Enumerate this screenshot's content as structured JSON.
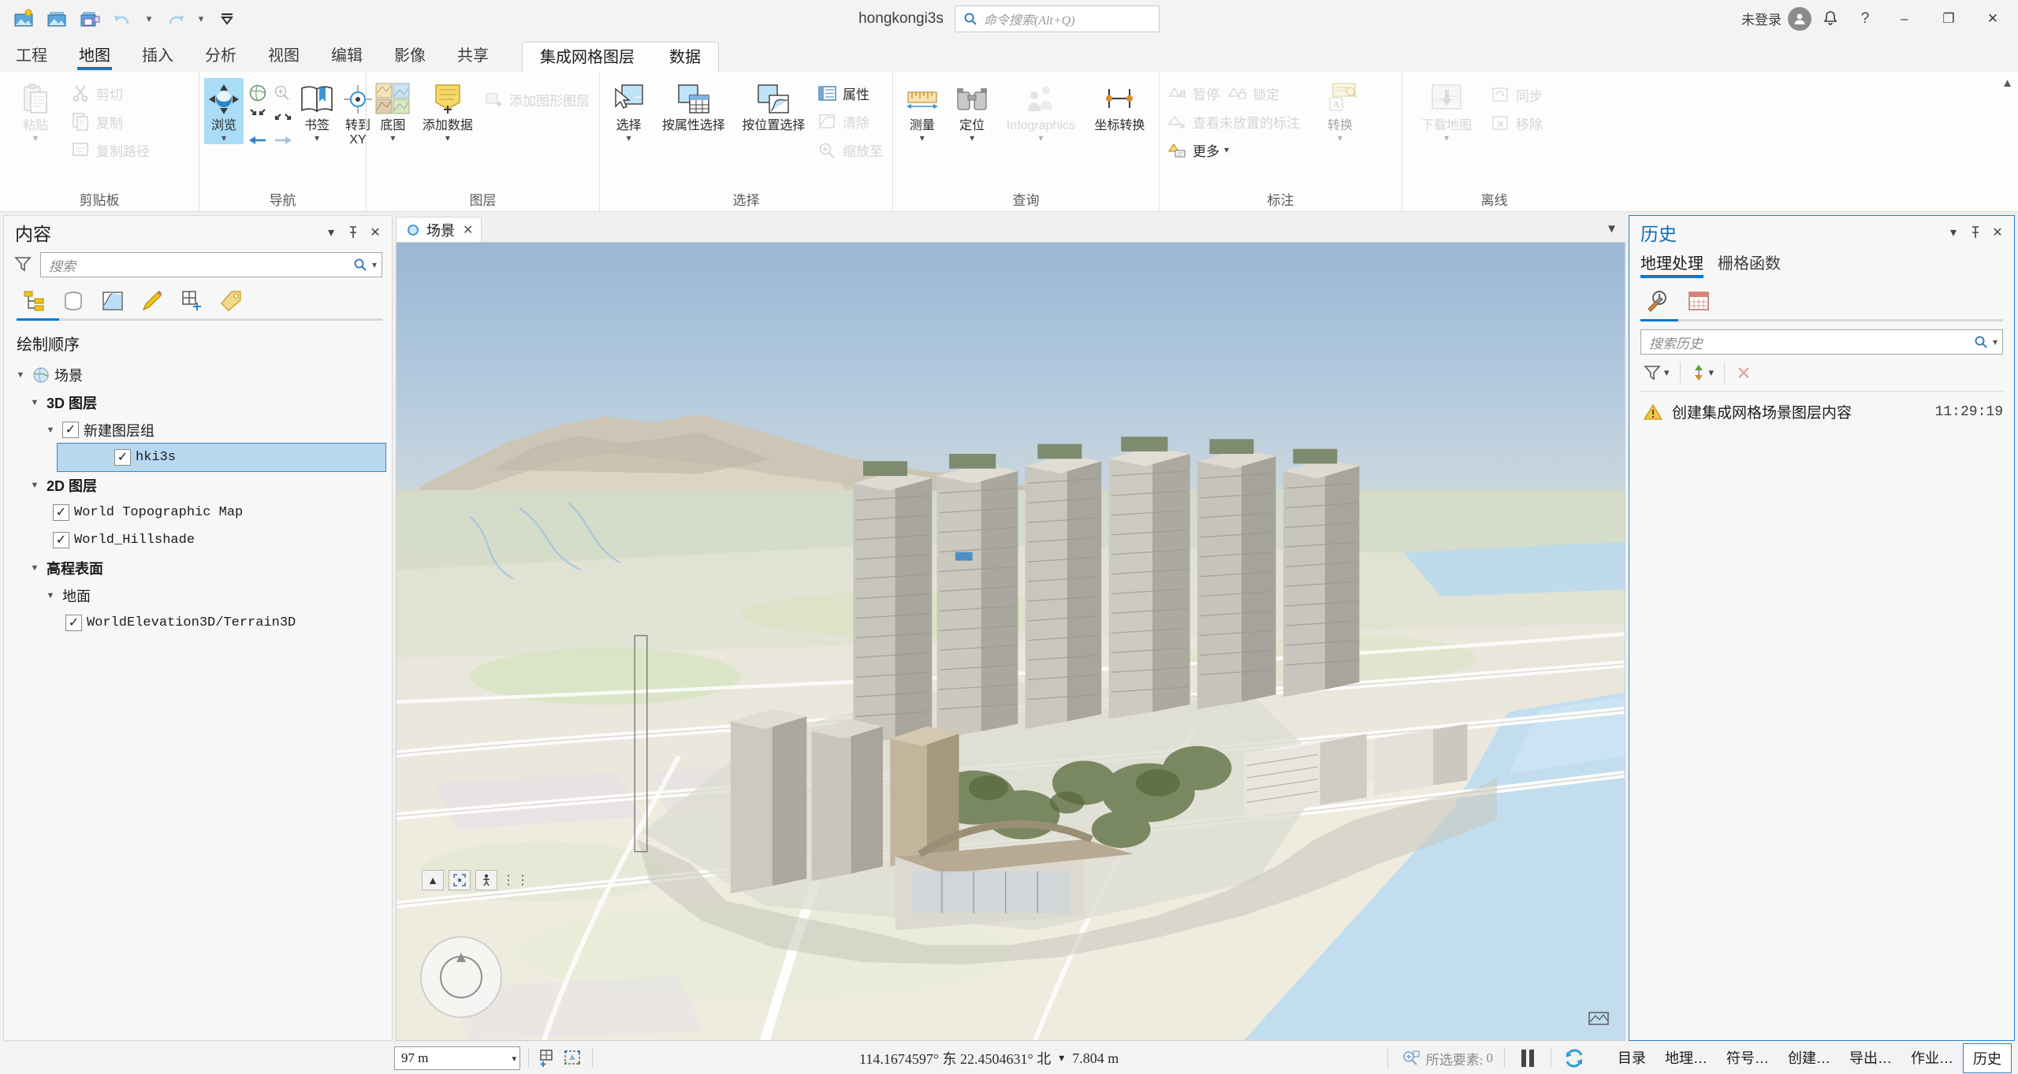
{
  "titlebar": {
    "project_title": "hongkongi3s",
    "command_search_placeholder": "命令搜索(Alt+Q)",
    "sign_in_label": "未登录",
    "quick_access": [
      {
        "name": "new-project",
        "tooltip": "新建工程"
      },
      {
        "name": "open-project",
        "tooltip": "打开工程"
      },
      {
        "name": "save-project",
        "tooltip": "保存工程"
      },
      {
        "name": "undo",
        "tooltip": "撤消"
      },
      {
        "name": "redo",
        "tooltip": "恢复"
      },
      {
        "name": "customize-qat",
        "tooltip": "自定义快速访问工具栏"
      }
    ],
    "window_controls": {
      "minimize": "–",
      "maximize": "❐",
      "close": "✕"
    }
  },
  "ribbon_tabs": [
    {
      "label": "工程",
      "active": false
    },
    {
      "label": "地图",
      "active": true
    },
    {
      "label": "插入",
      "active": false
    },
    {
      "label": "分析",
      "active": false
    },
    {
      "label": "视图",
      "active": false
    },
    {
      "label": "编辑",
      "active": false
    },
    {
      "label": "影像",
      "active": false
    },
    {
      "label": "共享",
      "active": false
    }
  ],
  "contextual_tabs": {
    "group_name": "集成网格图层",
    "tabs": [
      {
        "label": "集成网格图层",
        "active": true
      },
      {
        "label": "数据",
        "active": false
      }
    ]
  },
  "ribbon_groups": [
    {
      "label": "剪贴板",
      "big": [
        {
          "label": "粘贴",
          "icon": "paste-icon",
          "disabled": true,
          "has_menu": true
        }
      ],
      "small": [
        {
          "label": "剪切",
          "icon": "cut-icon",
          "disabled": true
        },
        {
          "label": "复制",
          "icon": "copy-icon",
          "disabled": true
        },
        {
          "label": "复制路径",
          "icon": "copy-path-icon",
          "disabled": true
        }
      ]
    },
    {
      "label": "导航",
      "big": [
        {
          "label": "浏览",
          "icon": "explore-icon",
          "active": true,
          "has_menu": true
        },
        {
          "label": "书签",
          "icon": "bookmark-icon",
          "has_menu": true
        },
        {
          "label": "转到 XY",
          "icon": "go-to-xy-icon",
          "has_menu": true
        }
      ],
      "grid": [
        {
          "icon": "full-extent-icon"
        },
        {
          "icon": "fixed-zoom-in-icon"
        },
        {
          "icon": "zoom-in-box-icon"
        },
        {
          "icon": "zoom-out-box-icon"
        },
        {
          "icon": "previous-extent-icon"
        },
        {
          "icon": "next-extent-icon"
        }
      ]
    },
    {
      "label": "图层",
      "big": [
        {
          "label": "底图",
          "icon": "basemap-icon",
          "has_menu": true
        },
        {
          "label": "添加数据",
          "icon": "add-data-icon",
          "has_menu": true
        }
      ],
      "small": [
        {
          "label": "添加图形图层",
          "icon": "add-graphics-layer-icon",
          "disabled": true
        }
      ]
    },
    {
      "label": "选择",
      "big": [
        {
          "label": "选择",
          "icon": "select-icon",
          "has_menu": true
        },
        {
          "label": "按属性选择",
          "icon": "select-by-attributes-icon"
        },
        {
          "label": "按位置选择",
          "icon": "select-by-location-icon"
        }
      ],
      "small": [
        {
          "label": "属性",
          "icon": "attributes-icon"
        },
        {
          "label": "清除",
          "icon": "clear-selection-icon",
          "disabled": true
        },
        {
          "label": "缩放至",
          "icon": "zoom-to-selection-icon",
          "disabled": true
        }
      ],
      "has_dialog_launcher": true
    },
    {
      "label": "查询",
      "big": [
        {
          "label": "测量",
          "icon": "measure-icon",
          "has_menu": true
        },
        {
          "label": "定位",
          "icon": "locate-icon",
          "has_menu": true
        },
        {
          "label": "Infographics",
          "icon": "infographics-icon",
          "disabled": true,
          "has_menu": true
        },
        {
          "label": "坐标转换",
          "icon": "coordinate-conversion-icon"
        }
      ]
    },
    {
      "label": "标注",
      "small": [
        {
          "label": "暂停",
          "icon": "pause-labeling-icon",
          "disabled": true
        },
        {
          "label": "锁定",
          "icon": "lock-labeling-icon",
          "disabled": true
        },
        {
          "label": "查看未放置的标注",
          "icon": "view-unplaced-labels-icon",
          "disabled": true
        },
        {
          "label": "更多",
          "icon": "more-labeling-icon",
          "has_menu": true
        }
      ],
      "big": [
        {
          "label": "转换",
          "icon": "convert-labels-icon",
          "disabled": true,
          "has_menu": true
        }
      ],
      "has_dialog_launcher": true
    },
    {
      "label": "离线",
      "big": [
        {
          "label": "下载地图",
          "icon": "download-map-icon",
          "disabled": true,
          "has_menu": true
        }
      ],
      "small": [
        {
          "label": "同步",
          "icon": "sync-icon",
          "disabled": true
        },
        {
          "label": "移除",
          "icon": "remove-offline-icon",
          "disabled": true
        }
      ],
      "has_dialog_launcher": true
    }
  ],
  "contents_pane": {
    "title": "内容",
    "search_placeholder": "搜索",
    "tab_icons": [
      {
        "name": "list-by-drawing-order-icon",
        "active": true
      },
      {
        "name": "list-by-data-source-icon",
        "active": false
      },
      {
        "name": "list-by-selection-icon",
        "active": false
      },
      {
        "name": "list-by-editing-icon",
        "active": false
      },
      {
        "name": "list-by-snapping-icon",
        "active": false
      },
      {
        "name": "list-by-labeling-icon",
        "active": false
      }
    ],
    "section_title": "绘制顺序",
    "tree": [
      {
        "label": "场景",
        "indent": 0,
        "arrow": "down",
        "checkbox": null,
        "icon": "globe-icon",
        "bold": false,
        "selected": false,
        "mono": false
      },
      {
        "label": "3D 图层",
        "indent": 1,
        "arrow": "down",
        "checkbox": null,
        "icon": null,
        "bold": true,
        "selected": false,
        "mono": false
      },
      {
        "label": "新建图层组",
        "indent": 2,
        "arrow": "down",
        "checkbox": true,
        "icon": null,
        "bold": false,
        "selected": false,
        "mono": false
      },
      {
        "label": "hki3s",
        "indent": 3,
        "arrow": null,
        "checkbox": true,
        "icon": null,
        "bold": false,
        "selected": true,
        "mono": true
      },
      {
        "label": "2D 图层",
        "indent": 1,
        "arrow": "down",
        "checkbox": null,
        "icon": null,
        "bold": true,
        "selected": false,
        "mono": false
      },
      {
        "label": "World Topographic Map",
        "indent": 2,
        "arrow": null,
        "checkbox": true,
        "icon": null,
        "bold": false,
        "selected": false,
        "mono": true
      },
      {
        "label": "World_Hillshade",
        "indent": 2,
        "arrow": null,
        "checkbox": true,
        "icon": null,
        "bold": false,
        "selected": false,
        "mono": true
      },
      {
        "label": "高程表面",
        "indent": 1,
        "arrow": "down",
        "checkbox": null,
        "icon": null,
        "bold": true,
        "selected": false,
        "mono": false
      },
      {
        "label": "地面",
        "indent": 2,
        "arrow": "down",
        "checkbox": null,
        "icon": null,
        "bold": false,
        "selected": false,
        "mono": false
      },
      {
        "label": "WorldElevation3D/Terrain3D",
        "indent": 3,
        "arrow": null,
        "checkbox": true,
        "icon": null,
        "bold": false,
        "selected": false,
        "mono": true
      }
    ]
  },
  "map_view": {
    "tab_label": "场景",
    "close_label": "✕"
  },
  "history_pane": {
    "title": "历史",
    "tabs": [
      {
        "label": "地理处理",
        "active": true
      },
      {
        "label": "栅格函数",
        "active": false
      }
    ],
    "icons": [
      {
        "name": "tool-history-icon",
        "active": true
      },
      {
        "name": "schedule-icon",
        "active": false
      }
    ],
    "search_placeholder": "搜索历史",
    "toolbar": [
      {
        "name": "filter-icon",
        "has_menu": true
      },
      {
        "name": "sort-icon",
        "has_menu": true
      },
      {
        "name": "delete-icon",
        "has_menu": false
      }
    ],
    "items": [
      {
        "status": "warning",
        "label": "创建集成网格场景图层内容",
        "time": "11:29:19"
      }
    ]
  },
  "statusbar": {
    "scale_value": "97 m",
    "coordinates": "114.1674597° 东  22.4504631° 北",
    "elevation": "7.804 m",
    "selected_features_label": "所选要素:",
    "selected_features_count": "0",
    "icons": [
      {
        "name": "add-new-map-icon"
      },
      {
        "name": "select-drawing-icon"
      },
      {
        "name": "pause-drawing-icon"
      },
      {
        "name": "refresh-icon"
      }
    ],
    "bottom_tabs": [
      {
        "label": "目录",
        "active": false
      },
      {
        "label": "地理…",
        "active": false
      },
      {
        "label": "符号…",
        "active": false
      },
      {
        "label": "创建…",
        "active": false
      },
      {
        "label": "导出…",
        "active": false
      },
      {
        "label": "作业…",
        "active": false
      },
      {
        "label": "历史",
        "active": true
      }
    ]
  },
  "colors": {
    "accent": "#0078d4",
    "ribbon_bg": "#fdfdfd",
    "chrome_bg": "#f3f3f3",
    "selected_row": "#b8d8f0",
    "active_tool": "#a8dcf7"
  }
}
